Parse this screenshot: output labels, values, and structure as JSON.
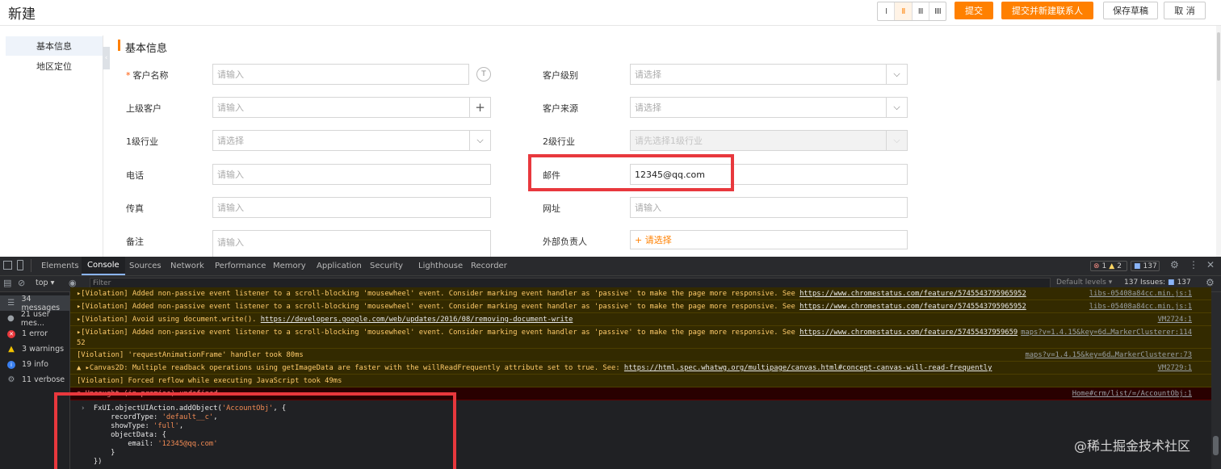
{
  "header": {
    "title": "新建",
    "layout_buttons": [
      "I",
      "II",
      "III",
      "IIII"
    ],
    "buttons": {
      "submit": "提交",
      "submit_new_contact": "提交并新建联系人",
      "save_draft": "保存草稿",
      "cancel": "取 消"
    }
  },
  "sidebar": {
    "items": [
      {
        "label": "基本信息"
      },
      {
        "label": "地区定位"
      }
    ],
    "collapse_glyph": "‹"
  },
  "section": {
    "title": "基本信息"
  },
  "form": {
    "customer_name": {
      "label": "客户名称",
      "required_mark": "*",
      "placeholder": "请输入",
      "icon_glyph": "T"
    },
    "customer_level": {
      "label": "客户级别",
      "placeholder": "请选择"
    },
    "parent_customer": {
      "label": "上级客户",
      "placeholder": "请输入",
      "add_glyph": "+"
    },
    "customer_source": {
      "label": "客户来源",
      "placeholder": "请选择"
    },
    "industry_1": {
      "label": "1级行业",
      "placeholder": "请选择"
    },
    "industry_2": {
      "label": "2级行业",
      "placeholder": "请先选择1级行业"
    },
    "phone": {
      "label": "电话",
      "placeholder": "请输入"
    },
    "email": {
      "label": "邮件",
      "value": "12345@qq.com"
    },
    "fax": {
      "label": "传真",
      "placeholder": "请输入"
    },
    "website": {
      "label": "网址",
      "placeholder": "请输入"
    },
    "remark": {
      "label": "备注",
      "placeholder": "请输入"
    },
    "external_owner": {
      "label": "外部负责人",
      "value": "+ 请选择"
    }
  },
  "devtools": {
    "tabs": [
      "Elements",
      "Console",
      "Sources",
      "Network",
      "Performance",
      "Memory",
      "Application",
      "Security",
      "Lighthouse",
      "Recorder"
    ],
    "badges": {
      "errors": "1",
      "warnings": "2",
      "issues": "137"
    },
    "toolbar": {
      "context": "top",
      "filter_placeholder": "Filter",
      "default_levels": "Default levels",
      "issues_label": "137 Issues:",
      "issues_count": "137"
    },
    "sidebar": [
      {
        "label": "34 messages",
        "icon": "list-icon",
        "color": "#5f6368"
      },
      {
        "label": "21 user mes...",
        "icon": "user-icon",
        "color": "#5f6368"
      },
      {
        "label": "1 error",
        "icon": "error-icon",
        "color": "#e8383d"
      },
      {
        "label": "3 warnings",
        "icon": "warning-icon",
        "color": "#f2c200"
      },
      {
        "label": "19 info",
        "icon": "info-icon",
        "color": "#3a80f0"
      },
      {
        "label": "11 verbose",
        "icon": "gear-icon",
        "color": "#5f6368"
      }
    ],
    "messages": [
      {
        "type": "warn",
        "text": "▸[Violation] Added non-passive event listener to a scroll-blocking 'mousewheel' event. Consider marking event handler as 'passive' to make the page more responsive. See ",
        "link": "https://www.chromestatus.com/feature/5745543795965952",
        "source": "libs-05408a84cc.min.js:1"
      },
      {
        "type": "warn",
        "text": "▸[Violation] Added non-passive event listener to a scroll-blocking 'mousewheel' event. Consider marking event handler as 'passive' to make the page more responsive. See ",
        "link": "https://www.chromestatus.com/feature/5745543795965952",
        "source": "libs-05408a84cc.min.js:1"
      },
      {
        "type": "warn",
        "text": "▸[Violation] Avoid using document.write(). ",
        "link": "https://developers.google.com/web/updates/2016/08/removing-document-write",
        "source": "VM2724:1"
      },
      {
        "type": "warn",
        "text": "▸[Violation] Added non-passive event listener to a scroll-blocking 'mousewheel' event. Consider marking event handler as 'passive' to make the page more responsive. See ",
        "link": "https://www.chromestatus.com/feature/57455437959659",
        "source": "maps?v=1.4.15&key=6d…MarkerClusterer:114",
        "cont": "52"
      },
      {
        "type": "warn",
        "text": "[Violation] 'requestAnimationFrame' handler took 80ms",
        "link": "",
        "source": "maps?v=1.4.15&key=6d…MarkerClusterer:73"
      },
      {
        "type": "warn",
        "text": "▲ ▸Canvas2D: Multiple readback operations using getImageData are faster with the willReadFrequently attribute set to true. See: ",
        "link": "https://html.spec.whatwg.org/multipage/canvas.html#concept-canvas-will-read-frequently",
        "source": "VM2729:1"
      },
      {
        "type": "warn",
        "text": "[Violation] Forced reflow while executing JavaScript took 49ms",
        "link": "",
        "source": ""
      },
      {
        "type": "err",
        "text": "⊗ Uncaught (in promise) undefined",
        "link": "",
        "source": "Home#crm/list/=/AccountObj:1"
      }
    ],
    "code": {
      "l1a": "FxUI.objectUIAction.addObject(",
      "l1s": "'AccountObj'",
      "l1b": ", {",
      "l2a": "    recordType: ",
      "l2s": "'default__c'",
      "l2b": ",",
      "l3a": "    showType: ",
      "l3s": "'full'",
      "l3b": ",",
      "l4": "    objectData: {",
      "l5a": "        email: ",
      "l5s": "'12345@qq.com'",
      "l6": "    }",
      "l7": "})"
    }
  },
  "watermark": "@稀土掘金技术社区"
}
